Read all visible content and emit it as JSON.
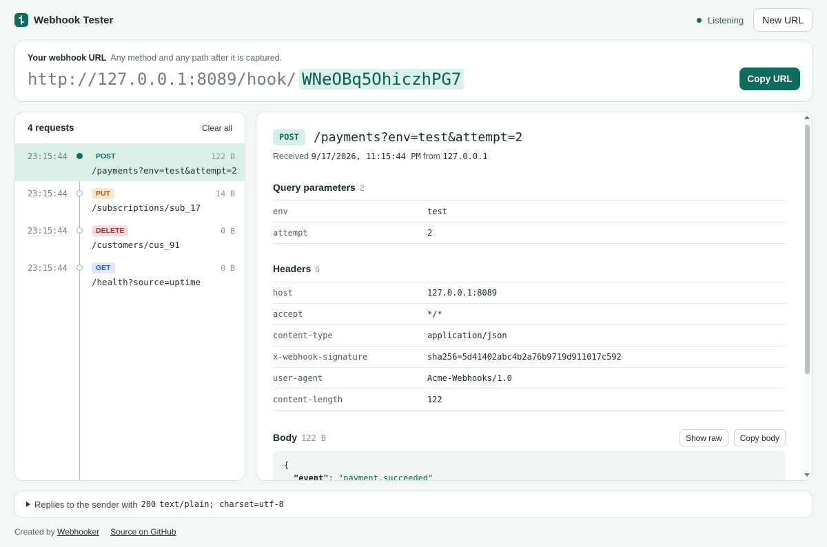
{
  "app": {
    "title": "Webhook Tester",
    "status": "Listening",
    "new_url_label": "New URL"
  },
  "url_card": {
    "heading": "Your webhook URL",
    "hint": "Any method and any path after it is captured.",
    "base": "http://127.0.0.1:8089/hook/",
    "token": "WNeOBq5OhiczhPG7",
    "copy_label": "Copy URL"
  },
  "requests": {
    "count_label": "4 requests",
    "clear_label": "Clear all",
    "items": [
      {
        "time": "23:15:44",
        "method": "POST",
        "size": "122 B",
        "path": "/payments?env=test&attempt=2"
      },
      {
        "time": "23:15:44",
        "method": "PUT",
        "size": "14 B",
        "path": "/subscriptions/sub_17"
      },
      {
        "time": "23:15:44",
        "method": "DELETE",
        "size": "0 B",
        "path": "/customers/cus_91"
      },
      {
        "time": "23:15:44",
        "method": "GET",
        "size": "0 B",
        "path": "/health?source=uptime"
      }
    ]
  },
  "detail": {
    "method": "POST",
    "path": "/payments?env=test&attempt=2",
    "received_label": "Received",
    "received_time": "9/17/2026, 11:15:44 PM",
    "from_label": "from",
    "from_ip": "127.0.0.1",
    "query": {
      "title": "Query parameters",
      "count": "2",
      "rows": [
        {
          "k": "env",
          "v": "test"
        },
        {
          "k": "attempt",
          "v": "2"
        }
      ]
    },
    "headers": {
      "title": "Headers",
      "count": "6",
      "rows": [
        {
          "k": "host",
          "v": "127.0.0.1:8089"
        },
        {
          "k": "accept",
          "v": "*/*"
        },
        {
          "k": "content-type",
          "v": "application/json"
        },
        {
          "k": "x-webhook-signature",
          "v": "sha256=5d41402abc4b2a76b9719d911017c592"
        },
        {
          "k": "user-agent",
          "v": "Acme-Webhooks/1.0"
        },
        {
          "k": "content-length",
          "v": "122"
        }
      ]
    },
    "body": {
      "title": "Body",
      "size": "122 B",
      "show_raw_label": "Show raw",
      "copy_body_label": "Copy body",
      "line1": "{",
      "key": "\"event\"",
      "colon": ": ",
      "value": "\"payment.succeeded\""
    }
  },
  "reply": {
    "text": "Replies to the sender with",
    "status_code": "200",
    "content_type": "text/plain; charset=utf-8"
  },
  "footer": {
    "created_by": "Created by",
    "creator_link": "Webhooker",
    "source_link": "Source on GitHub"
  }
}
